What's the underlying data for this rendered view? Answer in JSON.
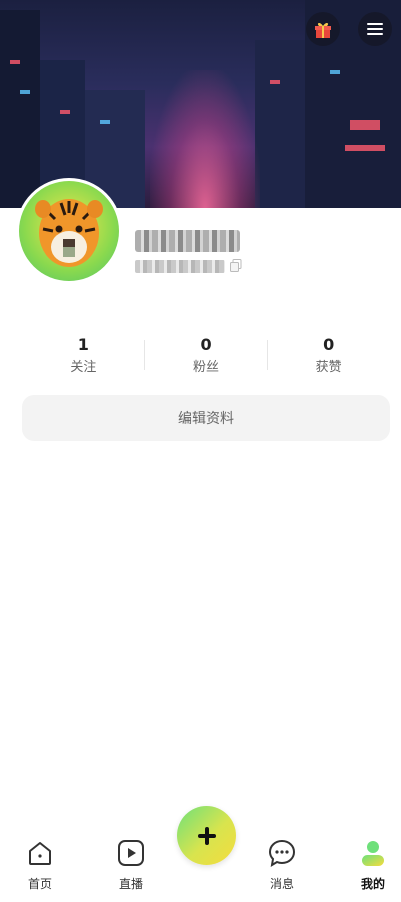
{
  "header": {
    "gift_icon": "gift-icon",
    "menu_icon": "menu-icon"
  },
  "profile": {
    "avatar_icon": "tiger-avatar"
  },
  "stats": [
    {
      "value": "1",
      "label": "关注"
    },
    {
      "value": "0",
      "label": "粉丝"
    },
    {
      "value": "0",
      "label": "获赞"
    }
  ],
  "edit_profile_label": "编辑资料",
  "tabbar": {
    "items": [
      {
        "label": "首页",
        "icon": "home-icon"
      },
      {
        "label": "直播",
        "icon": "play-icon"
      },
      {
        "label": "消息",
        "icon": "message-icon"
      },
      {
        "label": "我的",
        "icon": "user-icon"
      }
    ],
    "fab_icon": "plus-icon",
    "active_color": "#111111",
    "accent_gradient": [
      "#6ee07a",
      "#f5dc3e"
    ]
  }
}
